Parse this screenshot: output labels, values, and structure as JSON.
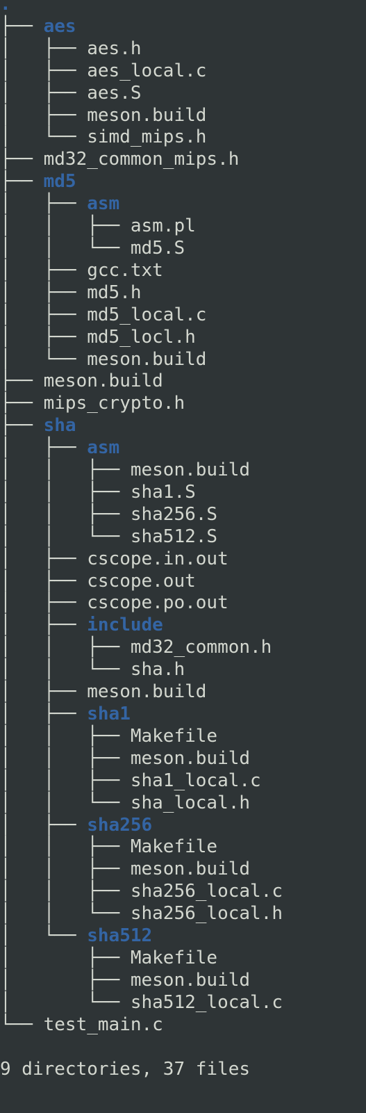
{
  "terminal": {
    "background": "#2e3436",
    "text_color": "#d3d7cf",
    "directory_color": "#3465a4",
    "lines": [
      {
        "prefix": "",
        "name": ".",
        "type": "dir"
      },
      {
        "prefix": "├── ",
        "name": "aes",
        "type": "dir"
      },
      {
        "prefix": "│   ├── ",
        "name": "aes.h",
        "type": "file"
      },
      {
        "prefix": "│   ├── ",
        "name": "aes_local.c",
        "type": "file"
      },
      {
        "prefix": "│   ├── ",
        "name": "aes.S",
        "type": "file"
      },
      {
        "prefix": "│   ├── ",
        "name": "meson.build",
        "type": "file"
      },
      {
        "prefix": "│   └── ",
        "name": "simd_mips.h",
        "type": "file"
      },
      {
        "prefix": "├── ",
        "name": "md32_common_mips.h",
        "type": "file"
      },
      {
        "prefix": "├── ",
        "name": "md5",
        "type": "dir"
      },
      {
        "prefix": "│   ├── ",
        "name": "asm",
        "type": "dir"
      },
      {
        "prefix": "│   │   ├── ",
        "name": "asm.pl",
        "type": "file"
      },
      {
        "prefix": "│   │   └── ",
        "name": "md5.S",
        "type": "file"
      },
      {
        "prefix": "│   ├── ",
        "name": "gcc.txt",
        "type": "file"
      },
      {
        "prefix": "│   ├── ",
        "name": "md5.h",
        "type": "file"
      },
      {
        "prefix": "│   ├── ",
        "name": "md5_local.c",
        "type": "file"
      },
      {
        "prefix": "│   ├── ",
        "name": "md5_locl.h",
        "type": "file"
      },
      {
        "prefix": "│   └── ",
        "name": "meson.build",
        "type": "file"
      },
      {
        "prefix": "├── ",
        "name": "meson.build",
        "type": "file"
      },
      {
        "prefix": "├── ",
        "name": "mips_crypto.h",
        "type": "file"
      },
      {
        "prefix": "├── ",
        "name": "sha",
        "type": "dir"
      },
      {
        "prefix": "│   ├── ",
        "name": "asm",
        "type": "dir"
      },
      {
        "prefix": "│   │   ├── ",
        "name": "meson.build",
        "type": "file"
      },
      {
        "prefix": "│   │   ├── ",
        "name": "sha1.S",
        "type": "file"
      },
      {
        "prefix": "│   │   ├── ",
        "name": "sha256.S",
        "type": "file"
      },
      {
        "prefix": "│   │   └── ",
        "name": "sha512.S",
        "type": "file"
      },
      {
        "prefix": "│   ├── ",
        "name": "cscope.in.out",
        "type": "file"
      },
      {
        "prefix": "│   ├── ",
        "name": "cscope.out",
        "type": "file"
      },
      {
        "prefix": "│   ├── ",
        "name": "cscope.po.out",
        "type": "file"
      },
      {
        "prefix": "│   ├── ",
        "name": "include",
        "type": "dir"
      },
      {
        "prefix": "│   │   ├── ",
        "name": "md32_common.h",
        "type": "file"
      },
      {
        "prefix": "│   │   └── ",
        "name": "sha.h",
        "type": "file"
      },
      {
        "prefix": "│   ├── ",
        "name": "meson.build",
        "type": "file"
      },
      {
        "prefix": "│   ├── ",
        "name": "sha1",
        "type": "dir"
      },
      {
        "prefix": "│   │   ├── ",
        "name": "Makefile",
        "type": "file"
      },
      {
        "prefix": "│   │   ├── ",
        "name": "meson.build",
        "type": "file"
      },
      {
        "prefix": "│   │   ├── ",
        "name": "sha1_local.c",
        "type": "file"
      },
      {
        "prefix": "│   │   └── ",
        "name": "sha_local.h",
        "type": "file"
      },
      {
        "prefix": "│   ├── ",
        "name": "sha256",
        "type": "dir"
      },
      {
        "prefix": "│   │   ├── ",
        "name": "Makefile",
        "type": "file"
      },
      {
        "prefix": "│   │   ├── ",
        "name": "meson.build",
        "type": "file"
      },
      {
        "prefix": "│   │   ├── ",
        "name": "sha256_local.c",
        "type": "file"
      },
      {
        "prefix": "│   │   └── ",
        "name": "sha256_local.h",
        "type": "file"
      },
      {
        "prefix": "│   └── ",
        "name": "sha512",
        "type": "dir"
      },
      {
        "prefix": "│       ├── ",
        "name": "Makefile",
        "type": "file"
      },
      {
        "prefix": "│       ├── ",
        "name": "meson.build",
        "type": "file"
      },
      {
        "prefix": "│       └── ",
        "name": "sha512_local.c",
        "type": "file"
      },
      {
        "prefix": "└── ",
        "name": "test_main.c",
        "type": "file"
      },
      {
        "prefix": "",
        "name": "",
        "type": "blank"
      },
      {
        "prefix": "",
        "name": "9 directories, 37 files",
        "type": "summary"
      }
    ]
  }
}
